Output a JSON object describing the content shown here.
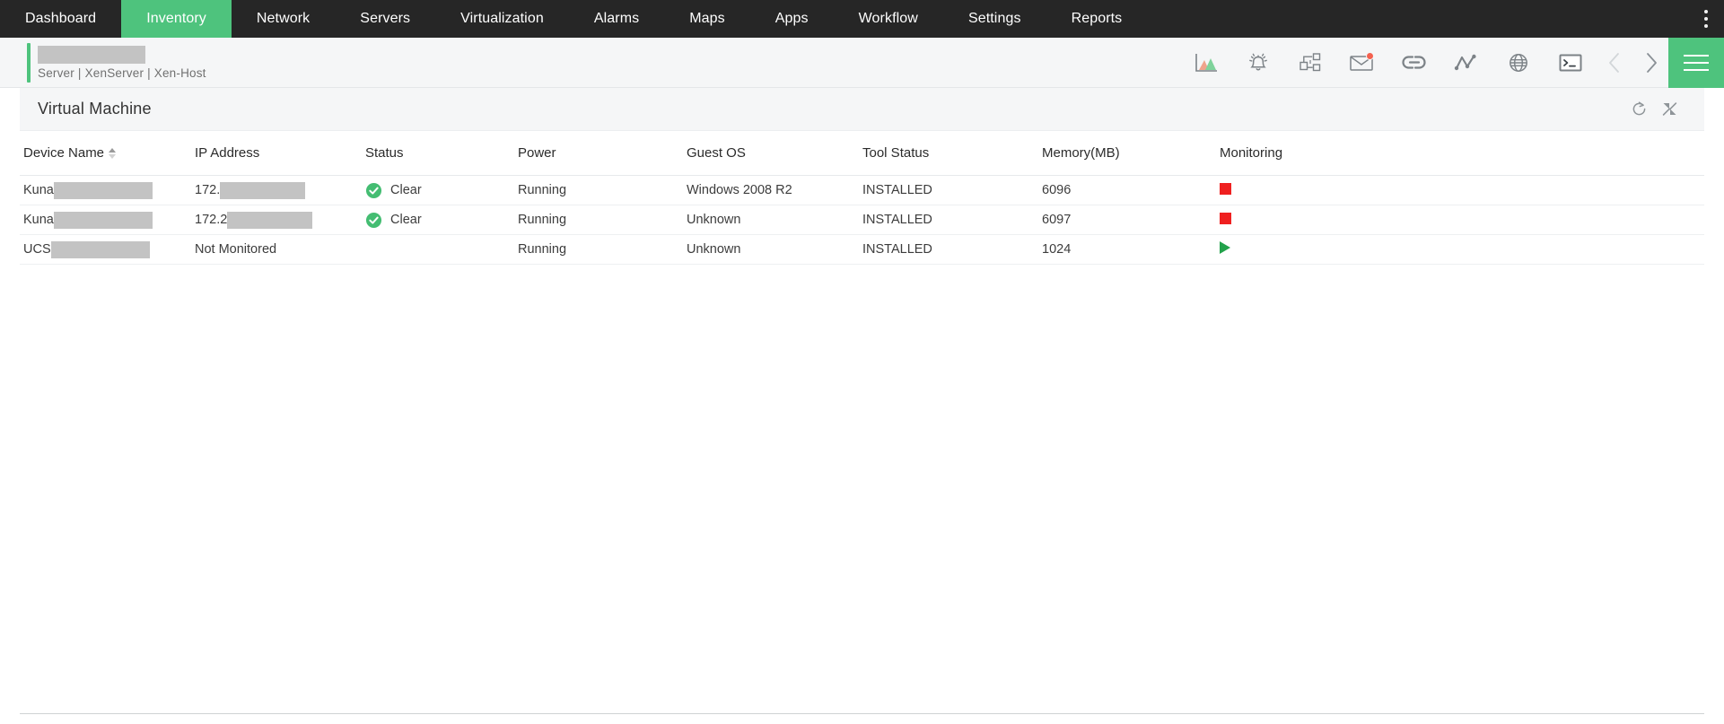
{
  "topnav": {
    "items": [
      {
        "label": "Dashboard",
        "active": false
      },
      {
        "label": "Inventory",
        "active": true
      },
      {
        "label": "Network",
        "active": false
      },
      {
        "label": "Servers",
        "active": false
      },
      {
        "label": "Virtualization",
        "active": false
      },
      {
        "label": "Alarms",
        "active": false
      },
      {
        "label": "Maps",
        "active": false
      },
      {
        "label": "Apps",
        "active": false
      },
      {
        "label": "Workflow",
        "active": false
      },
      {
        "label": "Settings",
        "active": false
      },
      {
        "label": "Reports",
        "active": false
      }
    ],
    "overflow_menu_icon": "kebab-menu-icon",
    "background_color": "#262626",
    "active_color": "#4ec37d"
  },
  "subheader": {
    "title_redacted": true,
    "breadcrumb": "Server | XenServer  | Xen-Host",
    "accent_color": "#4ec37d",
    "toolbar": [
      {
        "name": "performance-chart-icon",
        "label": "Performance"
      },
      {
        "name": "alert-bell-icon",
        "label": "Alerts"
      },
      {
        "name": "workflow-diagram-icon",
        "label": "Workflow"
      },
      {
        "name": "mail-icon",
        "label": "Notifications",
        "badge": true
      },
      {
        "name": "link-chain-icon",
        "label": "Associations"
      },
      {
        "name": "topology-line-icon",
        "label": "Topology"
      },
      {
        "name": "globe-icon",
        "label": "Web"
      },
      {
        "name": "terminal-icon",
        "label": "Terminal"
      }
    ],
    "prev_label": "Previous",
    "next_label": "Next",
    "prev_disabled": true,
    "menu_label": "Menu"
  },
  "panel": {
    "title": "Virtual Machine",
    "refresh_label": "Refresh",
    "collapse_label": "Collapse"
  },
  "table": {
    "columns": [
      {
        "key": "device_name",
        "label": "Device Name",
        "sorted": true,
        "sort_dir": "asc"
      },
      {
        "key": "ip_address",
        "label": "IP Address",
        "sorted": false
      },
      {
        "key": "status",
        "label": "Status",
        "sorted": false
      },
      {
        "key": "power",
        "label": "Power",
        "sorted": false
      },
      {
        "key": "guest_os",
        "label": "Guest OS",
        "sorted": false
      },
      {
        "key": "tool_status",
        "label": "Tool Status",
        "sorted": false
      },
      {
        "key": "memory",
        "label": "Memory(MB)",
        "sorted": false
      },
      {
        "key": "monitoring",
        "label": "Monitoring",
        "sorted": false
      }
    ],
    "rows": [
      {
        "device_name_prefix": "Kuna",
        "device_name_redacted": true,
        "ip_prefix": "172.",
        "ip_redacted": true,
        "status": "Clear",
        "status_icon": "check-circle-icon",
        "power": "Running",
        "guest_os": "Windows 2008 R2",
        "tool_status": "INSTALLED",
        "memory": "6096",
        "monitoring_icon": "stop-square-icon",
        "monitoring_color": "#ef2020"
      },
      {
        "device_name_prefix": "Kuna",
        "device_name_redacted": true,
        "ip_prefix": "172.2",
        "ip_redacted": true,
        "status": "Clear",
        "status_icon": "check-circle-icon",
        "power": "Running",
        "guest_os": "Unknown",
        "tool_status": "INSTALLED",
        "memory": "6097",
        "monitoring_icon": "stop-square-icon",
        "monitoring_color": "#ef2020"
      },
      {
        "device_name_prefix": "UCS",
        "device_name_redacted": true,
        "ip_prefix": "Not Monitored",
        "ip_redacted": false,
        "status": "",
        "status_icon": "",
        "power": "Running",
        "guest_os": "Unknown",
        "tool_status": "INSTALLED",
        "memory": "1024",
        "monitoring_icon": "play-triangle-icon",
        "monitoring_color": "#22a24b"
      }
    ]
  }
}
